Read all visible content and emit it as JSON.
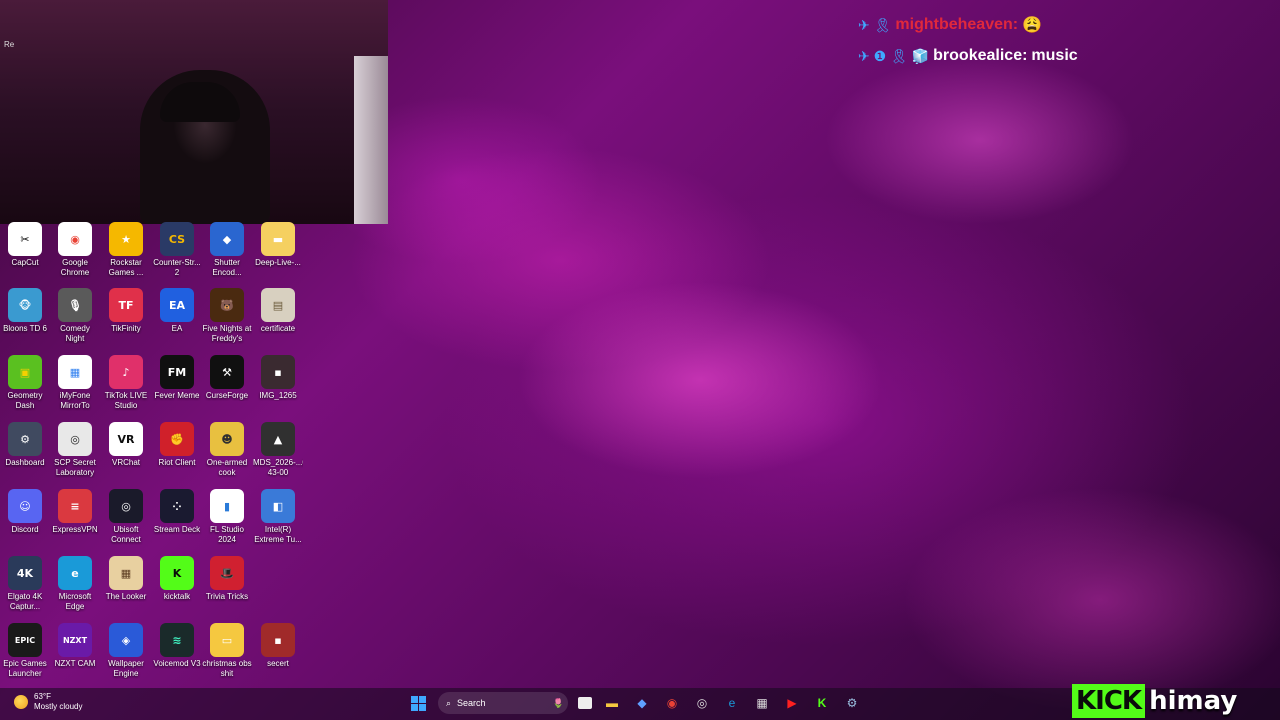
{
  "webcam": {
    "partial_label": "Re"
  },
  "chat": {
    "messages": [
      {
        "badges": "✈ 🎗",
        "user": "mightbeheaven:",
        "message": "😩"
      },
      {
        "badges": "✈ ❶ 🎗 🧊",
        "user": "brookealice:",
        "message": "music"
      }
    ]
  },
  "desktop_icons": [
    {
      "label": "CapCut",
      "glyph": "✂",
      "color": "#ffffff",
      "fg": "#000000"
    },
    {
      "label": "Google Chrome",
      "glyph": "◉",
      "color": "#ffffff",
      "fg": "#e94235"
    },
    {
      "label": "Rockstar Games ...",
      "glyph": "★",
      "color": "#f5b800",
      "fg": "#ffffff"
    },
    {
      "label": "Counter-Str... 2",
      "glyph": "CS",
      "color": "#2a3a66",
      "fg": "#f5b800"
    },
    {
      "label": "Shutter Encod...",
      "glyph": "◆",
      "color": "#2a66d0",
      "fg": "#ffffff"
    },
    {
      "label": "Deep-Live-...",
      "glyph": "▬",
      "color": "#f5d060",
      "fg": "#ffffff"
    },
    {
      "label": "Bloons TD 6",
      "glyph": "🐵",
      "color": "#3a9ad0",
      "fg": "#ffffff"
    },
    {
      "label": "Comedy Night",
      "glyph": "🎙",
      "color": "#5a5a5a",
      "fg": "#ffffff"
    },
    {
      "label": "TikFinity",
      "glyph": "TF",
      "color": "#e0304a",
      "fg": "#ffffff"
    },
    {
      "label": "EA",
      "glyph": "EA",
      "color": "#2060e0",
      "fg": "#ffffff"
    },
    {
      "label": "Five Nights at Freddy's",
      "glyph": "🐻",
      "color": "#4a2a10",
      "fg": "#ffffff"
    },
    {
      "label": "certificate",
      "glyph": "▤",
      "color": "#d8d0c0",
      "fg": "#6a5a3a"
    },
    {
      "label": "Geometry Dash",
      "glyph": "▣",
      "color": "#5ac020",
      "fg": "#f5d000"
    },
    {
      "label": "iMyFone MirrorTo",
      "glyph": "▦",
      "color": "#ffffff",
      "fg": "#3080f0"
    },
    {
      "label": "TikTok LIVE Studio",
      "glyph": "♪",
      "color": "#e0306a",
      "fg": "#ffffff"
    },
    {
      "label": "Fever Meme",
      "glyph": "FM",
      "color": "#101010",
      "fg": "#ffffff"
    },
    {
      "label": "CurseForge",
      "glyph": "⚒",
      "color": "#101010",
      "fg": "#ffffff"
    },
    {
      "label": "IMG_1265",
      "glyph": "▪",
      "color": "#3a2a30",
      "fg": "#ffffff"
    },
    {
      "label": "Dashboard",
      "glyph": "⚙",
      "color": "#404a60",
      "fg": "#ffffff"
    },
    {
      "label": "SCP Secret Laboratory",
      "glyph": "◎",
      "color": "#e8e8e8",
      "fg": "#202020"
    },
    {
      "label": "VRChat",
      "glyph": "VR",
      "color": "#ffffff",
      "fg": "#101010"
    },
    {
      "label": "Riot Client",
      "glyph": "✊",
      "color": "#d0202a",
      "fg": "#ffffff"
    },
    {
      "label": "One-armed cook",
      "glyph": "☻",
      "color": "#e8c040",
      "fg": "#303030"
    },
    {
      "label": "MDS_2026-...01-43-00",
      "glyph": "▲",
      "color": "#303030",
      "fg": "#ffffff"
    },
    {
      "label": "Discord",
      "glyph": "☺",
      "color": "#5865f2",
      "fg": "#ffffff"
    },
    {
      "label": "ExpressVPN",
      "glyph": "≡",
      "color": "#da3940",
      "fg": "#ffffff"
    },
    {
      "label": "Ubisoft Connect",
      "glyph": "◎",
      "color": "#1a1a2a",
      "fg": "#ffffff"
    },
    {
      "label": "Stream Deck",
      "glyph": "⁘",
      "color": "#1a1a30",
      "fg": "#ffffff"
    },
    {
      "label": "FL Studio 2024",
      "glyph": "▮",
      "color": "#ffffff",
      "fg": "#2a7ad8"
    },
    {
      "label": "Intel(R) Extreme Tu...",
      "glyph": "◧",
      "color": "#3a7ad8",
      "fg": "#ffffff"
    },
    {
      "label": "Elgato 4K Captur...",
      "glyph": "4K",
      "color": "#2a3a5a",
      "fg": "#ffffff"
    },
    {
      "label": "Microsoft Edge",
      "glyph": "e",
      "color": "#1a9ad8",
      "fg": "#ffffff"
    },
    {
      "label": "The Looker",
      "glyph": "▦",
      "color": "#e8d0a0",
      "fg": "#5a3a20"
    },
    {
      "label": "kicktalk",
      "glyph": "K",
      "color": "#53fc18",
      "fg": "#0b0b0b"
    },
    {
      "label": "Trivia Tricks",
      "glyph": "🎩",
      "color": "#d02030",
      "fg": "#ffffff"
    },
    {
      "label": "",
      "glyph": "",
      "color": "transparent",
      "fg": "#ffffff"
    },
    {
      "label": "Epic Games Launcher",
      "glyph": "EPIC",
      "color": "#1a1a1a",
      "fg": "#ffffff"
    },
    {
      "label": "NZXT CAM",
      "glyph": "NZXT",
      "color": "#6a1aa8",
      "fg": "#ffffff"
    },
    {
      "label": "Wallpaper Engine",
      "glyph": "◈",
      "color": "#2a5ad8",
      "fg": "#ffffff"
    },
    {
      "label": "Voicemod V3",
      "glyph": "≋",
      "color": "#1a2a2a",
      "fg": "#40f0c0"
    },
    {
      "label": "christmas obs shit",
      "glyph": "▭",
      "color": "#f5c840",
      "fg": "#ffffff"
    },
    {
      "label": "secert",
      "glyph": "▪",
      "color": "#a02a2a",
      "fg": "#ffffff"
    }
  ],
  "taskbar": {
    "temperature": "63°F",
    "weather": "Mostly cloudy",
    "search_label": "Search"
  },
  "overlay": {
    "kick_word": "KICK",
    "channel": "himay"
  }
}
